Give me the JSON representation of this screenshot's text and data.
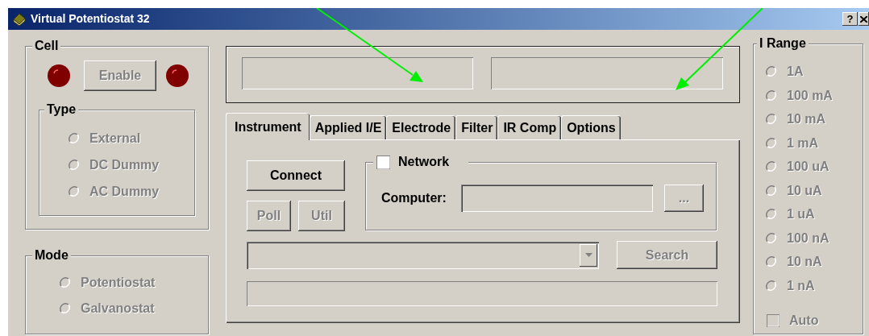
{
  "window": {
    "title": "Virtual Potentiostat 32",
    "help_button": "?"
  },
  "cell": {
    "title": "Cell",
    "enable_button": {
      "label": "Enable",
      "disabled": true
    },
    "indicators": [
      {
        "color": "#800000"
      },
      {
        "color": "#800000"
      }
    ],
    "type": {
      "title": "Type",
      "options": [
        {
          "label": "External",
          "selected": false,
          "disabled": true
        },
        {
          "label": "DC Dummy",
          "selected": false,
          "disabled": true
        },
        {
          "label": "AC Dummy",
          "selected": false,
          "disabled": true
        }
      ]
    }
  },
  "mode": {
    "title": "Mode",
    "options": [
      {
        "label": "Potentiostat",
        "selected": false,
        "disabled": true
      },
      {
        "label": "Galvanostat",
        "selected": false,
        "disabled": true
      }
    ]
  },
  "tabs": [
    {
      "label": "Instrument",
      "selected": true
    },
    {
      "label": "Applied I/E",
      "selected": false
    },
    {
      "label": "Electrode",
      "selected": false
    },
    {
      "label": "Filter",
      "selected": false
    },
    {
      "label": "IR Comp",
      "selected": false
    },
    {
      "label": "Options",
      "selected": false
    }
  ],
  "instrument": {
    "connect_button": {
      "label": "Connect",
      "disabled": false
    },
    "poll_button": {
      "label": "Poll",
      "disabled": true
    },
    "util_button": {
      "label": "Util",
      "disabled": true
    },
    "network": {
      "label": "Network",
      "checked": false,
      "computer_label": "Computer:",
      "browse_button": {
        "label": "...",
        "disabled": true
      }
    },
    "search_button": {
      "label": "Search",
      "disabled": true
    }
  },
  "i_range": {
    "title": "I Range",
    "options": [
      {
        "label": "1A",
        "selected": false,
        "disabled": true
      },
      {
        "label": "100 mA",
        "selected": false,
        "disabled": true
      },
      {
        "label": "10 mA",
        "selected": false,
        "disabled": true
      },
      {
        "label": "1 mA",
        "selected": false,
        "disabled": true
      },
      {
        "label": "100 uA",
        "selected": false,
        "disabled": true
      },
      {
        "label": "10 uA",
        "selected": false,
        "disabled": true
      },
      {
        "label": "1 uA",
        "selected": false,
        "disabled": true
      },
      {
        "label": "100 nA",
        "selected": false,
        "disabled": true
      },
      {
        "label": "10 nA",
        "selected": false,
        "disabled": true
      },
      {
        "label": "1 nA",
        "selected": false,
        "disabled": true
      }
    ],
    "auto": {
      "label": "Auto",
      "checked": false,
      "disabled": true
    }
  }
}
